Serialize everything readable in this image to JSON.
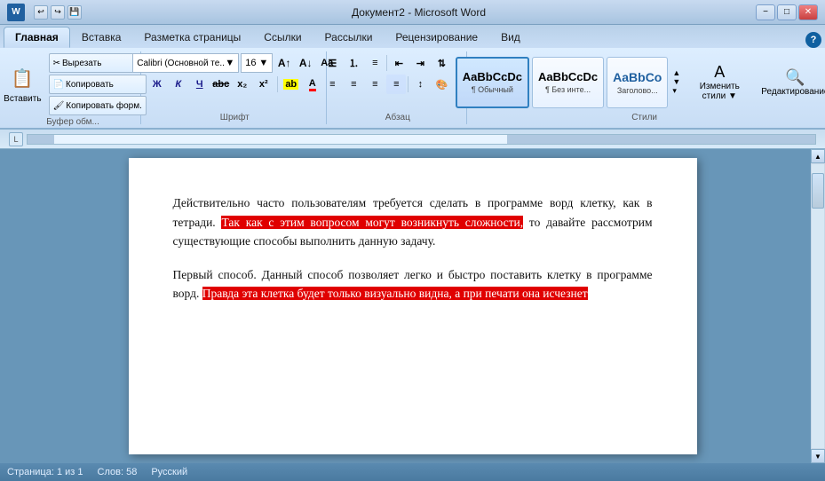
{
  "titlebar": {
    "title": "Документ2 - Microsoft Word",
    "app_icon": "W",
    "quick_buttons": [
      "↩",
      "↪",
      "💾",
      "✏"
    ],
    "controls": [
      "−",
      "□",
      "✕"
    ]
  },
  "ribbon": {
    "tabs": [
      "Главная",
      "Вставка",
      "Разметка страницы",
      "Ссылки",
      "Рассылки",
      "Рецензирование",
      "Вид"
    ],
    "active_tab": "Главная",
    "groups": {
      "clipboard": {
        "label": "Буфер обм...",
        "paste_label": "Вставить"
      },
      "font": {
        "label": "Шрифт",
        "font_name": "Calibri (Основной те...",
        "font_size": "16",
        "bold": "Ж",
        "italic": "К",
        "underline": "Ч",
        "strikethrough": "abc",
        "subscript": "x₂",
        "superscript": "x²",
        "increase": "A↑",
        "decrease": "A↓",
        "highlight": "ab",
        "color": "A"
      },
      "paragraph": {
        "label": "Абзац"
      },
      "styles": {
        "label": "Стили",
        "items": [
          {
            "preview": "AaBbCcDc",
            "label": "¶ Обычный",
            "active": true
          },
          {
            "preview": "AaBbCcDc",
            "label": "¶ Без инте...",
            "active": false
          },
          {
            "preview": "AaBbCo",
            "label": "Заголово...",
            "active": false
          }
        ],
        "change_styles_label": "Изменить стили ▼",
        "editing_label": "Редактирование"
      }
    }
  },
  "document": {
    "paragraphs": [
      {
        "id": "p1",
        "parts": [
          {
            "text": "Действительно часто пользователям требуется сделать в программе ворд клетку, как в тетради. ",
            "highlight": false
          },
          {
            "text": "Так как с этим вопросом могут возникнуть сложности,",
            "highlight": true
          },
          {
            "text": " то давайте рассмотрим существующие способы выполнить данную задачу.",
            "highlight": false
          }
        ]
      },
      {
        "id": "p2",
        "parts": [
          {
            "text": "Первый способ. Данный способ позволяет легко и быстро поставить клетку в программе ворд. ",
            "highlight": false
          },
          {
            "text": "Правда эта клетка будет только визуально видна, а при печати она исчезнет",
            "highlight": true
          }
        ]
      }
    ]
  },
  "statusbar": {
    "page_info": "Страница: 1 из 1",
    "words": "Слов: 58",
    "language": "Русский"
  }
}
